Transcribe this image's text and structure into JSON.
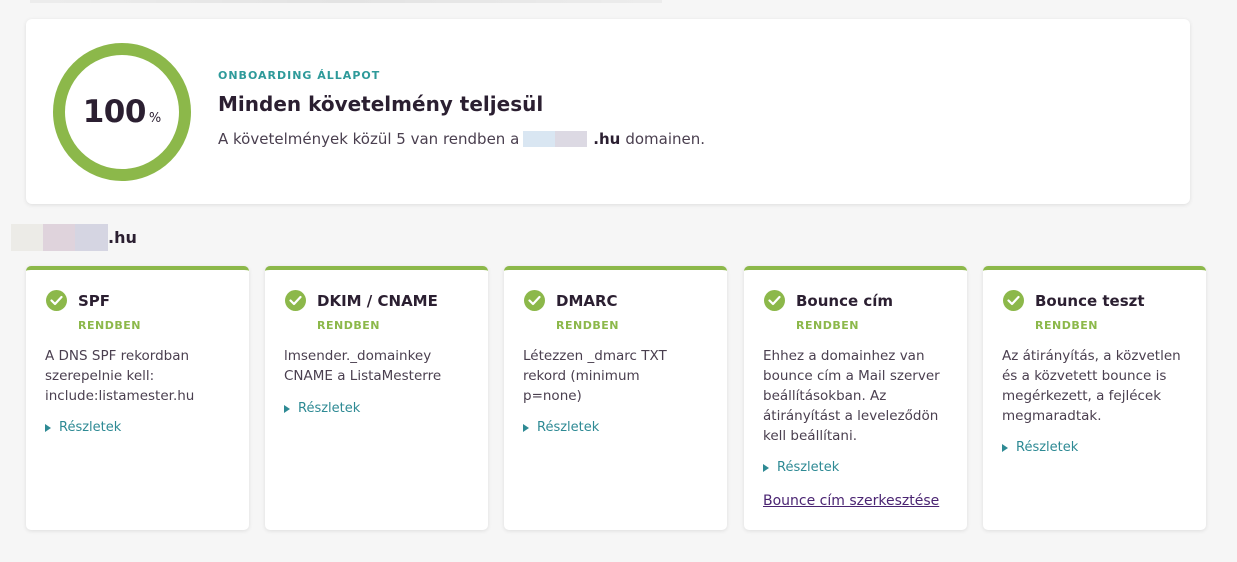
{
  "status": {
    "percent": "100",
    "unit": "%",
    "progress": 100,
    "eyebrow": "ONBOARDING ÁLLAPOT",
    "title": "Minden követelmény teljesül",
    "desc_prefix": "A követelmények közül 5 van rendben a",
    "domain_suffix": ".hu",
    "desc_suffix": "domainen."
  },
  "domain": {
    "suffix": ".hu"
  },
  "checks": [
    {
      "title": "SPF",
      "status": "RENDBEN",
      "desc": "A DNS SPF rekordban szerepelnie kell: include:listamester.hu",
      "details": "Részletek"
    },
    {
      "title": "DKIM / CNAME",
      "status": "RENDBEN",
      "desc": "lmsender._domainkey CNAME a ListaMesterre",
      "details": "Részletek"
    },
    {
      "title": "DMARC",
      "status": "RENDBEN",
      "desc": "Létezzen _dmarc TXT rekord (minimum p=none)",
      "details": "Részletek"
    },
    {
      "title": "Bounce cím",
      "status": "RENDBEN",
      "desc": "Ehhez a domainhez van bounce cím a Mail szerver beállításokban. Az átirányítást a leveleződön kell beállítani.",
      "details": "Részletek",
      "link": "Bounce cím szerkesztése"
    },
    {
      "title": "Bounce teszt",
      "status": "RENDBEN",
      "desc": "Az átirányítás, a közvetlen és a közvetett bounce is megérkezett, a fejlécek megmaradtak.",
      "details": "Részletek"
    }
  ],
  "colors": {
    "success": "#8cb84a",
    "accent": "#2e9a9a",
    "link": "#4a2472"
  },
  "icons": {
    "check": "check-circle-icon",
    "expand": "triangle-right-icon"
  }
}
